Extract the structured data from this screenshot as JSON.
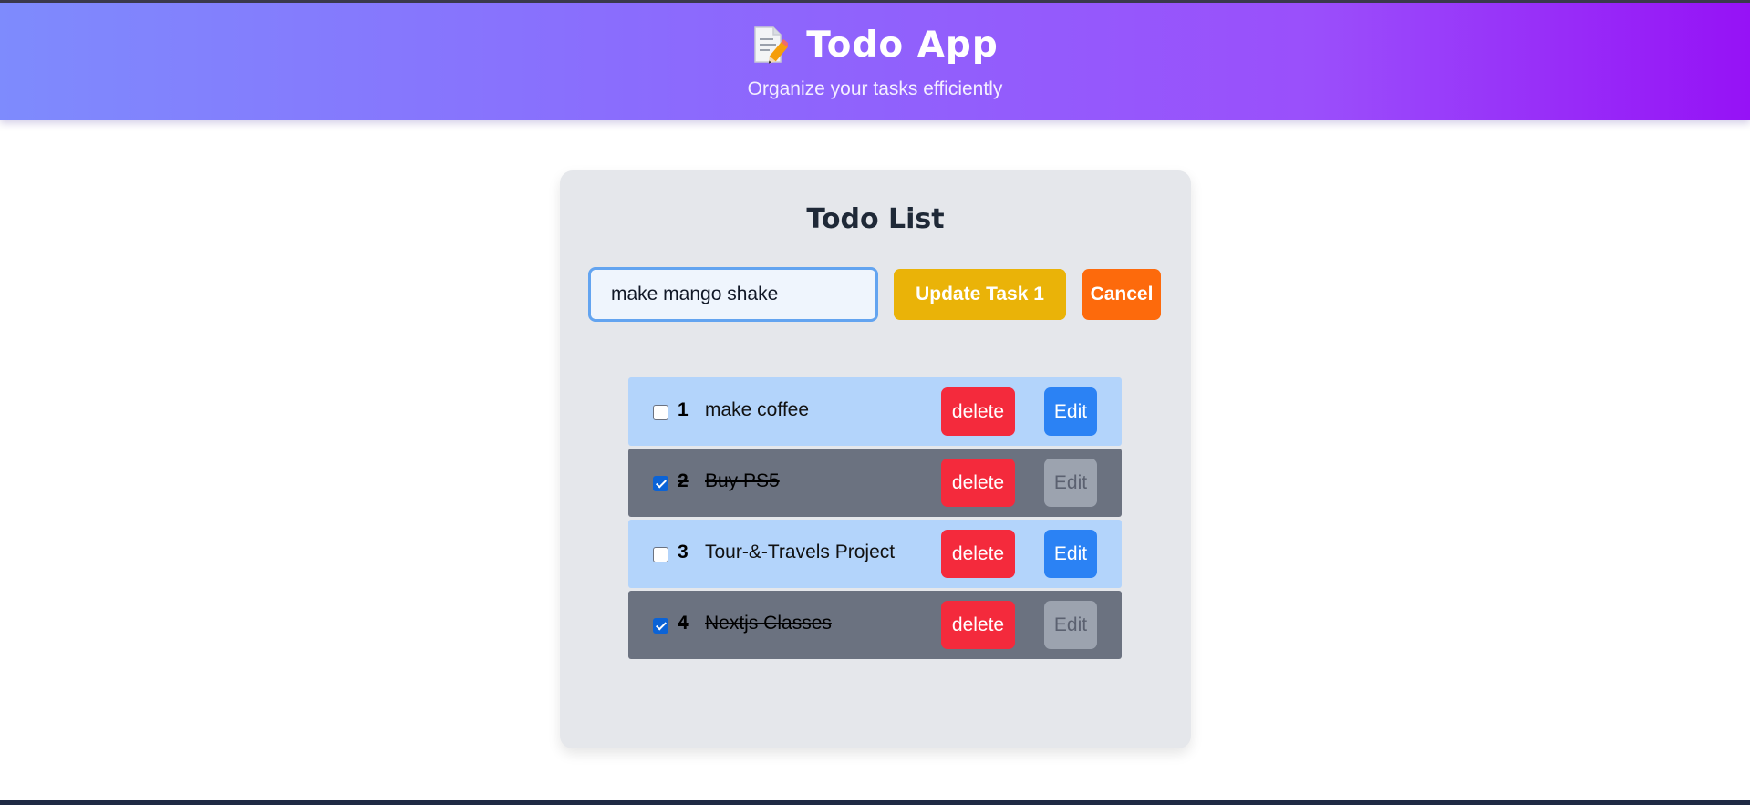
{
  "header": {
    "title": "Todo App",
    "subtitle": "Organize your tasks efficiently",
    "icon": "memo-icon"
  },
  "card": {
    "title": "Todo List",
    "input": {
      "value": "make mango shake",
      "placeholder": ""
    },
    "update_label": "Update Task 1",
    "cancel_label": "Cancel"
  },
  "todos": [
    {
      "num": "1",
      "text": "make coffee",
      "completed": false,
      "delete_label": "delete",
      "edit_label": "Edit"
    },
    {
      "num": "2",
      "text": "Buy PS5",
      "completed": true,
      "delete_label": "delete",
      "edit_label": "Edit"
    },
    {
      "num": "3",
      "text": "Tour-&-Travels Project",
      "completed": false,
      "delete_label": "delete",
      "edit_label": "Edit"
    },
    {
      "num": "4",
      "text": "Nextjs Classes",
      "completed": true,
      "delete_label": "delete",
      "edit_label": "Edit"
    }
  ],
  "colors": {
    "header_gradient_start": "#7e8bfd",
    "header_gradient_end": "#9612f6",
    "update_button": "#eab308",
    "cancel_button": "#fd6a0c",
    "delete_button": "#f42a3c",
    "edit_button": "#2b82f4",
    "edit_disabled": "#9ca3af",
    "row_active": "#b3d4fb",
    "row_completed": "#6b7280"
  }
}
